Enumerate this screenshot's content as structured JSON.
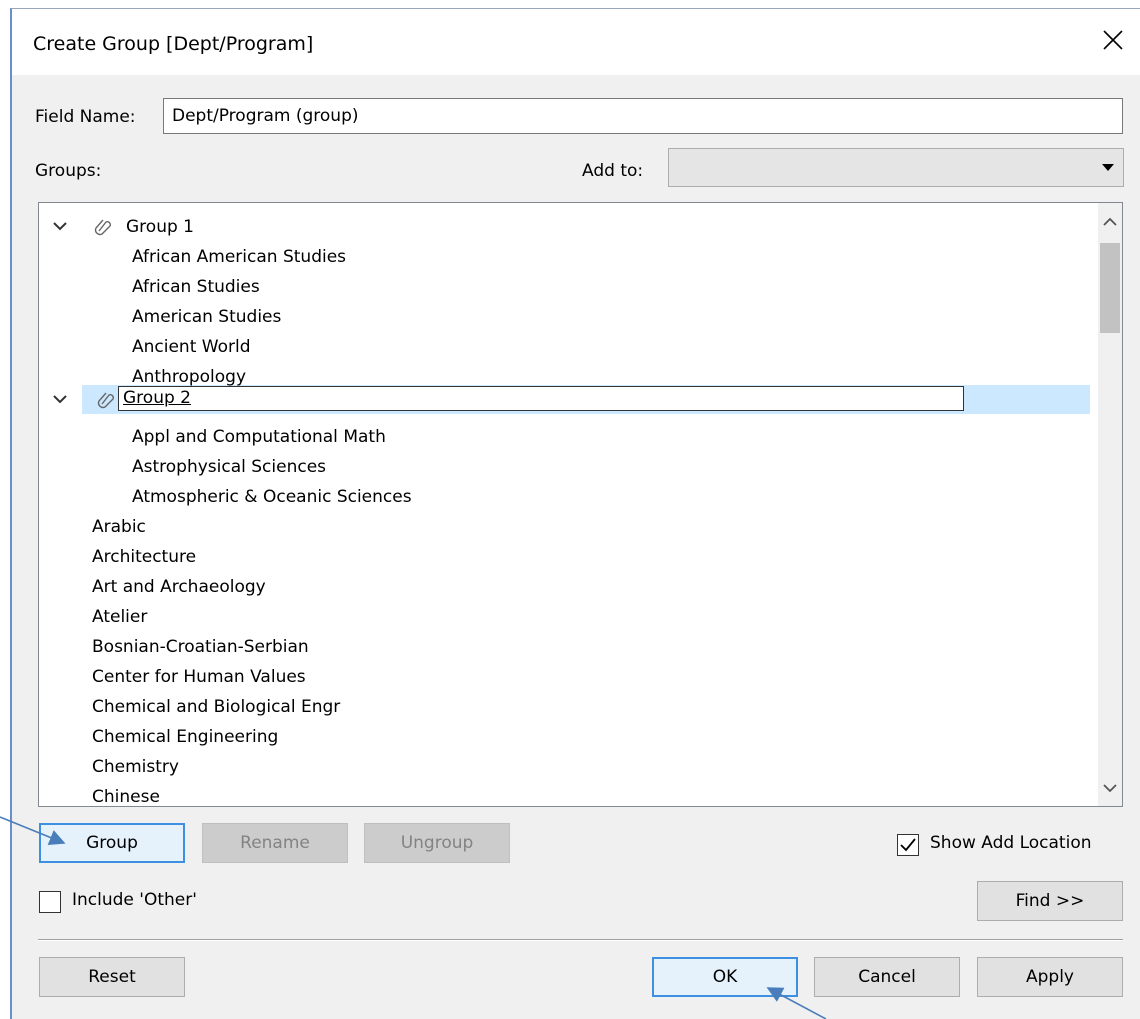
{
  "window": {
    "title": "Create Group [Dept/Program]"
  },
  "form": {
    "field_name_label": "Field Name:",
    "field_name_value": "Dept/Program (group)",
    "groups_label": "Groups:",
    "add_to_label": "Add to:",
    "add_to_value": ""
  },
  "tree": {
    "groups": [
      {
        "name": "Group 1",
        "expanded": true,
        "members": [
          "African American Studies",
          "African Studies",
          "American Studies",
          "Ancient World",
          "Anthropology"
        ]
      },
      {
        "name": "Group 2",
        "expanded": true,
        "editing": true,
        "members": [
          "Appl and Computational Math",
          "Astrophysical Sciences",
          "Atmospheric & Oceanic Sciences"
        ]
      }
    ],
    "items": [
      "Arabic",
      "Architecture",
      "Art and Archaeology",
      "Atelier",
      "Bosnian-Croatian-Serbian",
      "Center for Human Values",
      "Chemical and Biological Engr",
      "Chemical Engineering",
      "Chemistry",
      "Chinese"
    ]
  },
  "buttons": {
    "group": "Group",
    "rename": "Rename",
    "ungroup": "Ungroup",
    "find": "Find >>",
    "reset": "Reset",
    "ok": "OK",
    "cancel": "Cancel",
    "apply": "Apply"
  },
  "options": {
    "show_add_location_label": "Show Add Location",
    "show_add_location_checked": true,
    "include_other_label": "Include 'Other'",
    "include_other_checked": false
  },
  "icons": {
    "close": "close-icon",
    "expand": "chevron-down-icon",
    "group": "paperclip-icon",
    "dropdown": "caret-down-icon"
  },
  "colors": {
    "selection": "#cce8ff",
    "focus_border": "#3d8fe0",
    "annotation_arrow": "#4a7ebb"
  }
}
